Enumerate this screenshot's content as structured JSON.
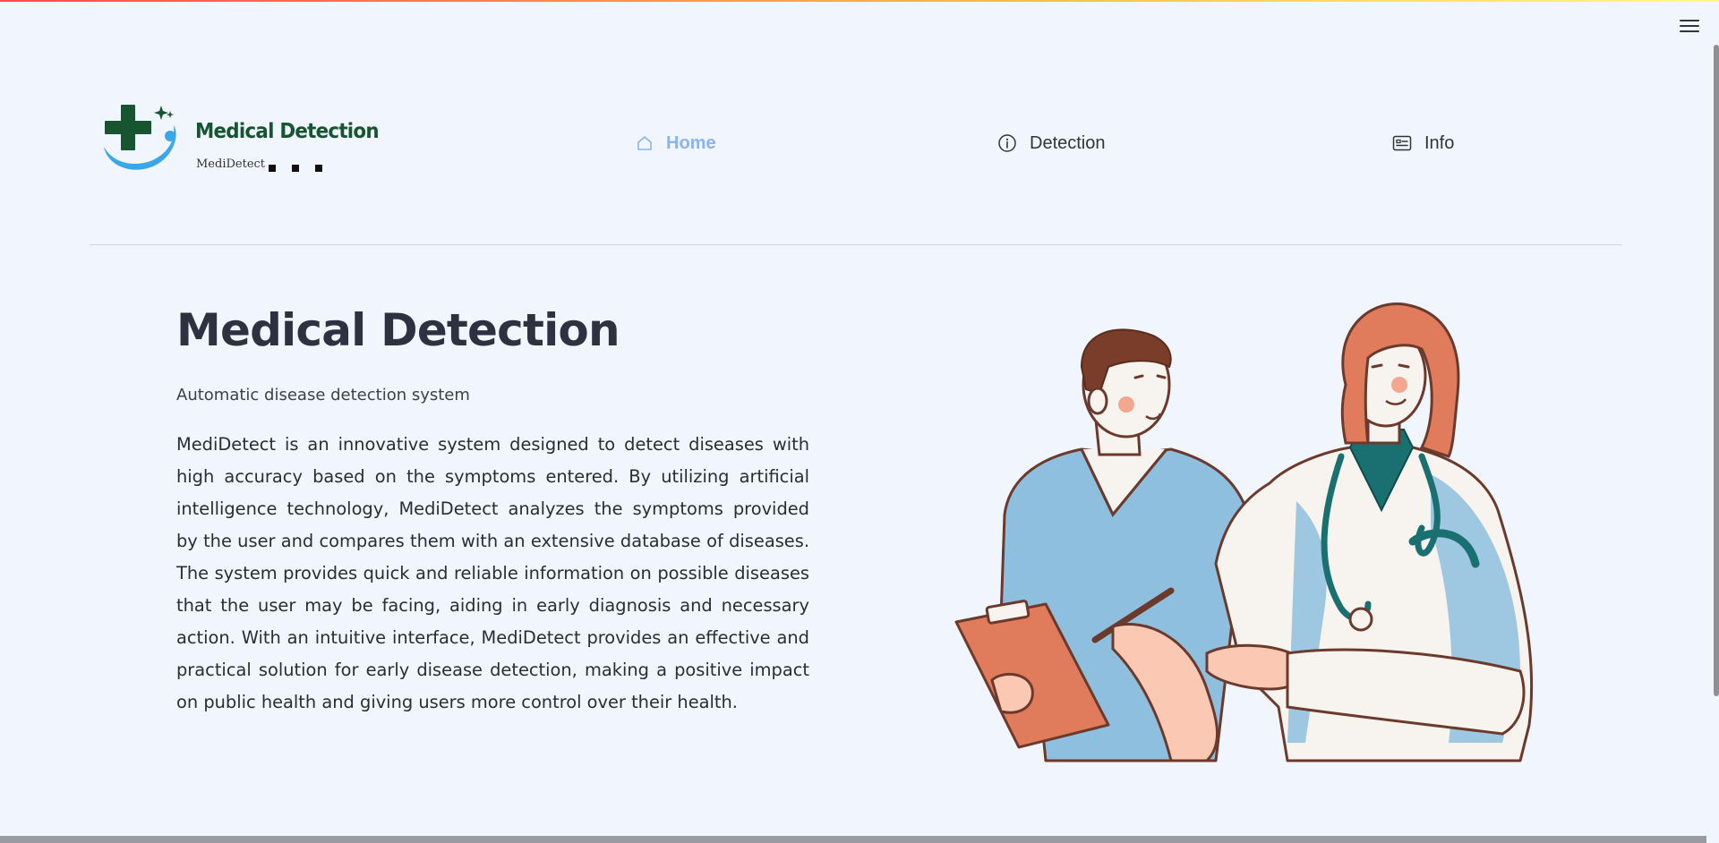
{
  "brand": {
    "title": "Medical Detection",
    "subtitle": "MediDetect",
    "colors": {
      "cross": "#16552f",
      "swoosh": "#3aa7e8"
    }
  },
  "nav": {
    "items": [
      {
        "label": "Home",
        "icon": "home-icon",
        "active": true
      },
      {
        "label": "Detection",
        "icon": "info-circle-icon",
        "active": false
      },
      {
        "label": "Info",
        "icon": "id-card-icon",
        "active": false
      }
    ],
    "active_color": "#8ab4f0"
  },
  "hero": {
    "title": "Medical Detection",
    "subtitle": "Automatic disease detection system",
    "description": "MediDetect is an innovative system designed to detect diseases with high accuracy based on the symptoms entered. By utilizing artificial intelligence technology, MediDetect analyzes the symptoms provided by the user and compares them with an extensive database of diseases. The system provides quick and reliable information on possible diseases that the user may be facing, aiding in early diagnosis and necessary action. With an intuitive interface, MediDetect provides an effective and practical solution for early disease detection, making a positive impact on public health and giving users more control over their health."
  },
  "illustration": {
    "subject": "doctors-illustration"
  },
  "menu": {
    "icon": "hamburger-menu-icon"
  }
}
